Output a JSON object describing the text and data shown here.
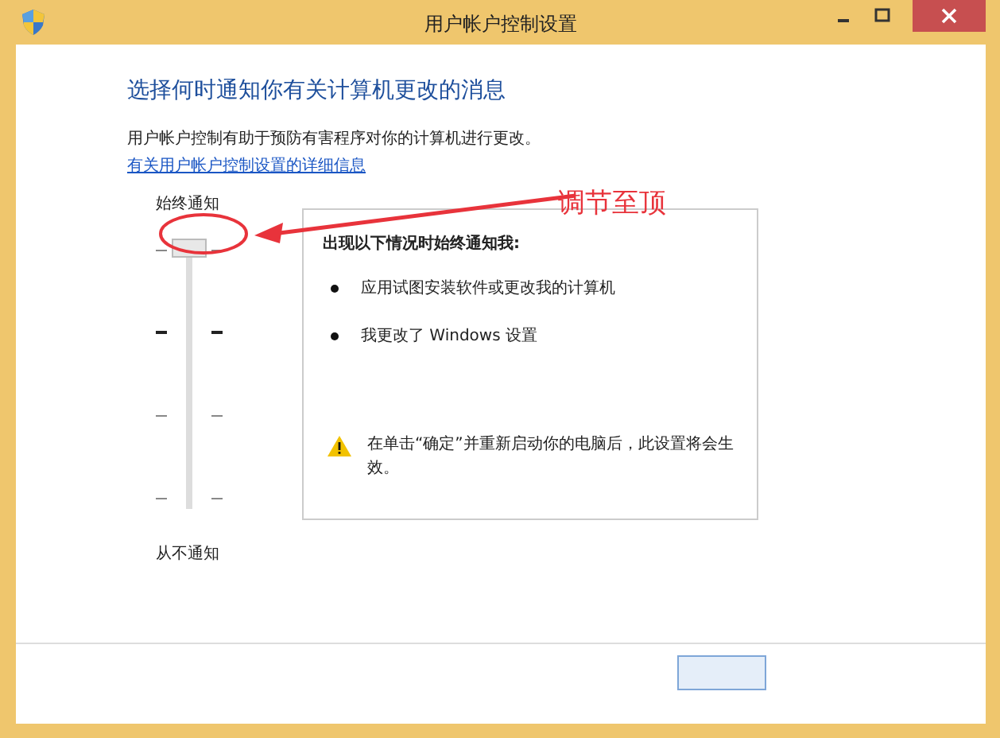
{
  "window": {
    "title": "用户帐户控制设置"
  },
  "heading": "选择何时通知你有关计算机更改的消息",
  "description": "用户帐户控制有助于预防有害程序对你的计算机进行更改。",
  "link": "有关用户帐户控制设置的详细信息",
  "slider": {
    "top_label": "始终通知",
    "bottom_label": "从不通知",
    "level": 1
  },
  "info": {
    "title": "出现以下情况时始终通知我:",
    "bullets": [
      "应用试图安装软件或更改我的计算机",
      "我更改了 Windows 设置"
    ],
    "warning": "在单击“确定”并重新启动你的电脑后，此设置将会生效。"
  },
  "annotation": {
    "text": "调节至顶"
  }
}
